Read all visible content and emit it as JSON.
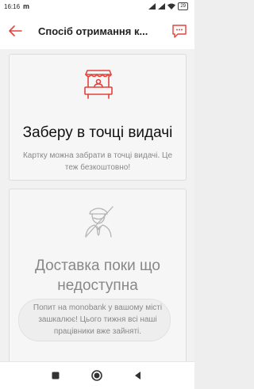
{
  "status_bar": {
    "time": "16:16",
    "carrier": "m",
    "battery": "29"
  },
  "app_bar": {
    "title": "Спосіб отримання к...",
    "back_icon": "arrow-left-icon",
    "chat_icon": "chat-icon"
  },
  "options": [
    {
      "icon": "pickup-kiosk-icon",
      "title": "Заберу в точці видачі",
      "description": "Картку можна забрати в точці видачі. Це теж безкоштовно!",
      "available": true
    },
    {
      "icon": "courier-person-icon",
      "title": "Доставка поки що недоступна",
      "description": "Попит на monobank у вашому місті зашкалює! Цього тижня всі наші працівники вже зайняті.",
      "available": false
    }
  ],
  "nav_bar": {
    "recent_icon": "recent-apps-icon",
    "home_icon": "home-icon",
    "back_icon": "back-triangle-icon"
  },
  "colors": {
    "accent": "#e2433b",
    "muted": "#888888",
    "card_bg": "#f6f6f6"
  }
}
